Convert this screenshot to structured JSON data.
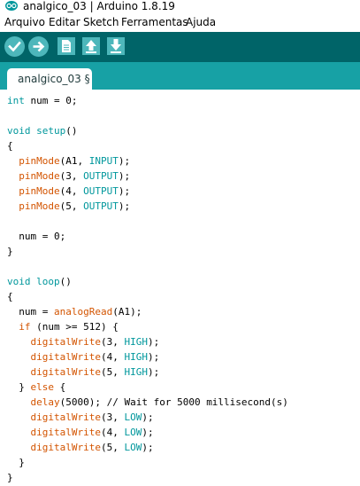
{
  "window": {
    "title": "analgico_03 | Arduino 1.8.19"
  },
  "menu": [
    "Arquivo",
    "Editar",
    "Sketch",
    "Ferramentas",
    "Ajuda"
  ],
  "toolbar": {
    "buttons": [
      {
        "name": "verify-button",
        "icon": "checkmark-icon"
      },
      {
        "name": "upload-button",
        "icon": "right-arrow-icon"
      },
      {
        "name": "new-button",
        "icon": "new-file-icon"
      },
      {
        "name": "open-button",
        "icon": "up-arrow-icon"
      },
      {
        "name": "save-button",
        "icon": "down-arrow-icon"
      }
    ]
  },
  "tab": {
    "label": "analgico_03 §"
  },
  "colors": {
    "toolbar": "#006468",
    "tabbar": "#17a1a5",
    "button": "#4db7bb",
    "keyword": "#00979c",
    "function": "#d35400",
    "comment": "#434f54"
  },
  "code": [
    [
      [
        "int",
        "kw"
      ],
      [
        " num = 0;",
        "plain"
      ]
    ],
    [],
    [
      [
        "void",
        "kw"
      ],
      [
        " ",
        "plain"
      ],
      [
        "setup",
        "kw"
      ],
      [
        "()",
        "plain"
      ]
    ],
    [
      [
        "{",
        "plain"
      ]
    ],
    [
      [
        "  ",
        "plain"
      ],
      [
        "pinMode",
        "fn"
      ],
      [
        "(A1, ",
        "plain"
      ],
      [
        "INPUT",
        "const"
      ],
      [
        ");",
        "plain"
      ]
    ],
    [
      [
        "  ",
        "plain"
      ],
      [
        "pinMode",
        "fn"
      ],
      [
        "(3, ",
        "plain"
      ],
      [
        "OUTPUT",
        "const"
      ],
      [
        ");",
        "plain"
      ]
    ],
    [
      [
        "  ",
        "plain"
      ],
      [
        "pinMode",
        "fn"
      ],
      [
        "(4, ",
        "plain"
      ],
      [
        "OUTPUT",
        "const"
      ],
      [
        ");",
        "plain"
      ]
    ],
    [
      [
        "  ",
        "plain"
      ],
      [
        "pinMode",
        "fn"
      ],
      [
        "(5, ",
        "plain"
      ],
      [
        "OUTPUT",
        "const"
      ],
      [
        ");",
        "plain"
      ]
    ],
    [],
    [
      [
        "  num = 0;",
        "plain"
      ]
    ],
    [
      [
        "}",
        "plain"
      ]
    ],
    [],
    [
      [
        "void",
        "kw"
      ],
      [
        " ",
        "plain"
      ],
      [
        "loop",
        "kw"
      ],
      [
        "()",
        "plain"
      ]
    ],
    [
      [
        "{",
        "plain"
      ]
    ],
    [
      [
        "  num = ",
        "plain"
      ],
      [
        "analogRead",
        "fn"
      ],
      [
        "(A1);",
        "plain"
      ]
    ],
    [
      [
        "  ",
        "plain"
      ],
      [
        "if",
        "fn"
      ],
      [
        " (num >= 512) {",
        "plain"
      ]
    ],
    [
      [
        "    ",
        "plain"
      ],
      [
        "digitalWrite",
        "fn"
      ],
      [
        "(3, ",
        "plain"
      ],
      [
        "HIGH",
        "const"
      ],
      [
        ");",
        "plain"
      ]
    ],
    [
      [
        "    ",
        "plain"
      ],
      [
        "digitalWrite",
        "fn"
      ],
      [
        "(4, ",
        "plain"
      ],
      [
        "HIGH",
        "const"
      ],
      [
        ");",
        "plain"
      ]
    ],
    [
      [
        "    ",
        "plain"
      ],
      [
        "digitalWrite",
        "fn"
      ],
      [
        "(5, ",
        "plain"
      ],
      [
        "HIGH",
        "const"
      ],
      [
        ");",
        "plain"
      ]
    ],
    [
      [
        "  } ",
        "plain"
      ],
      [
        "else",
        "fn"
      ],
      [
        " {",
        "plain"
      ]
    ],
    [
      [
        "    ",
        "plain"
      ],
      [
        "delay",
        "fn"
      ],
      [
        "(5000); // Wait for 5000 millisecond(s)",
        "plain"
      ]
    ],
    [
      [
        "    ",
        "plain"
      ],
      [
        "digitalWrite",
        "fn"
      ],
      [
        "(3, ",
        "plain"
      ],
      [
        "LOW",
        "const"
      ],
      [
        ");",
        "plain"
      ]
    ],
    [
      [
        "    ",
        "plain"
      ],
      [
        "digitalWrite",
        "fn"
      ],
      [
        "(4, ",
        "plain"
      ],
      [
        "LOW",
        "const"
      ],
      [
        ");",
        "plain"
      ]
    ],
    [
      [
        "    ",
        "plain"
      ],
      [
        "digitalWrite",
        "fn"
      ],
      [
        "(5, ",
        "plain"
      ],
      [
        "LOW",
        "const"
      ],
      [
        ");",
        "plain"
      ]
    ],
    [
      [
        "  }",
        "plain"
      ]
    ],
    [
      [
        "}",
        "plain"
      ]
    ]
  ]
}
